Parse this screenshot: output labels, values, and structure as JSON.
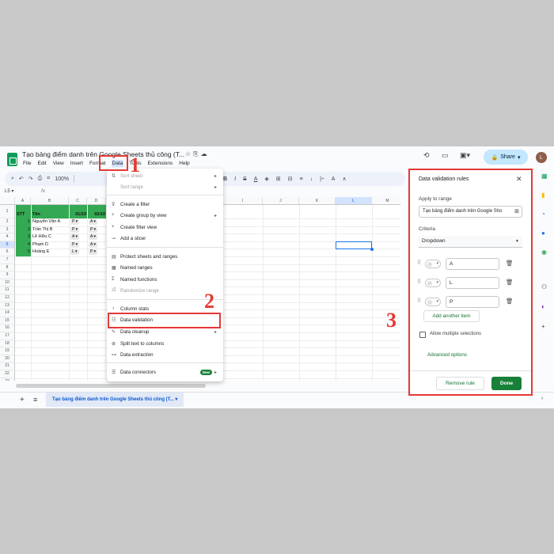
{
  "app": {
    "doc_title": "Tạo bảng điểm danh trên Google Sheets thủ công (T...",
    "menu": [
      "File",
      "Edit",
      "View",
      "Insert",
      "Format",
      "Data",
      "Tools",
      "Extensions",
      "Help"
    ],
    "active_menu": "Data",
    "share_label": "Share",
    "avatar_letter": "L"
  },
  "toolbar": {
    "zoom": "100%",
    "right_icons": [
      "B",
      "I",
      "S",
      "A",
      "◈",
      "⊞",
      "⊟",
      "≡",
      "↓",
      "|÷",
      "A",
      "∧"
    ]
  },
  "formula": {
    "cell_ref": "L5",
    "fx": "fx"
  },
  "grid": {
    "columns": [
      "A",
      "B",
      "C",
      "D",
      "",
      "",
      "",
      "",
      "I",
      "J",
      "K",
      "L",
      "M"
    ],
    "selected_column": "L",
    "rows": [
      "1",
      "2",
      "3",
      "4",
      "5",
      "6",
      "7",
      "8",
      "9",
      "10",
      "11",
      "12",
      "13",
      "14",
      "15",
      "16",
      "17",
      "18",
      "19",
      "20",
      "21",
      "22",
      "23",
      "24"
    ],
    "selected_row": "5",
    "header": {
      "stt": "STT",
      "ten": "Tên",
      "d1": "01/10",
      "d2": "02/10"
    },
    "students": [
      {
        "stt": "1",
        "name": "Nguyễn Văn A",
        "d1": "P",
        "d2": "A"
      },
      {
        "stt": "2",
        "name": "Trần Thị B",
        "d1": "P",
        "d2": "P"
      },
      {
        "stt": "3",
        "name": "Lê Hữu C",
        "d1": "A",
        "d2": "A"
      },
      {
        "stt": "4",
        "name": "Phạm D",
        "d1": "P",
        "d2": "A"
      },
      {
        "stt": "5",
        "name": "Hoàng E",
        "d1": "L",
        "d2": "P"
      }
    ]
  },
  "data_menu": {
    "items": [
      {
        "label": "Sort sheet",
        "disabled": true,
        "submenu": true
      },
      {
        "label": "Sort range",
        "disabled": true,
        "submenu": true
      },
      {
        "label": "Create a filter"
      },
      {
        "label": "Create group by view",
        "submenu": true
      },
      {
        "label": "Create filter view"
      },
      {
        "label": "Add a slicer"
      },
      {
        "label": "Protect sheets and ranges"
      },
      {
        "label": "Named ranges"
      },
      {
        "label": "Named functions"
      },
      {
        "label": "Randomize range",
        "disabled": true
      },
      {
        "label": "Column stats"
      },
      {
        "label": "Data validation"
      },
      {
        "label": "Data cleanup",
        "submenu": true
      },
      {
        "label": "Split text to columns"
      },
      {
        "label": "Data extraction"
      },
      {
        "label": "Data connectors",
        "badge": "New",
        "submenu": true
      }
    ]
  },
  "panel": {
    "title": "Data validation rules",
    "apply_label": "Apply to range",
    "range_value": "Tạo bảng điểm danh trên Google Sho",
    "criteria_label": "Criteria",
    "criteria_value": "Dropdown",
    "items": [
      "A",
      "L",
      "P"
    ],
    "add_item": "Add another item",
    "allow_multiple": "Allow multiple selections",
    "advanced": "Advanced options",
    "remove": "Remove rule",
    "done": "Done"
  },
  "sheet_tab": "Tạo bảng điểm danh trên Google Sheets thủ công (T...",
  "annotations": [
    "1",
    "2",
    "3"
  ],
  "colors": {
    "accent": "#188038",
    "annotation": "#e53935",
    "header_green": "#34a853"
  }
}
